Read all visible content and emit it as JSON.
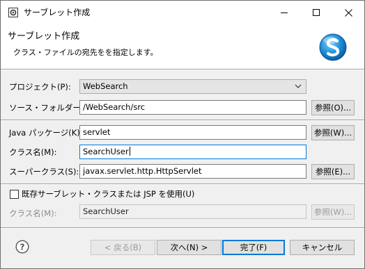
{
  "window": {
    "title": "サーブレット作成"
  },
  "banner": {
    "title": "サーブレット作成",
    "description": "クラス・ファイルの宛先をを指定します。"
  },
  "form": {
    "project_label": "プロジェクト(P):",
    "project_value": "WebSearch",
    "source_folder_label": "ソース・フォルダー(D):",
    "source_folder_value": "/WebSearch/src",
    "source_folder_browse": "参照(O)...",
    "package_label": "Java パッケージ(K):",
    "package_value": "servlet",
    "package_browse": "参照(W)...",
    "class_name_label": "クラス名(M):",
    "class_name_value": "SearchUser",
    "superclass_label": "スーパークラス(S):",
    "superclass_value": "javax.servlet.http.HttpServlet",
    "superclass_browse": "参照(E)...",
    "use_existing_label": "既存サーブレット・クラスまたは JSP を使用(U)",
    "use_existing_checked": false,
    "existing_class_label": "クラス名(M):",
    "existing_class_value": "SearchUser",
    "existing_class_browse": "参照(W)..."
  },
  "footer": {
    "back_label": "< 戻る(B)",
    "next_label": "次へ(N) >",
    "finish_label": "完了(F)",
    "cancel_label": "キャンセル"
  },
  "icons": {
    "app": "eclipse-gear-icon",
    "minimize": "minimize-icon",
    "maximize": "maximize-icon",
    "close": "close-icon",
    "logo": "servlet-s-logo-icon",
    "dropdown": "chevron-down-icon",
    "help": "help-icon"
  },
  "colors": {
    "focus_border": "#0078d7",
    "logo_blue": "#1e8fd8"
  }
}
